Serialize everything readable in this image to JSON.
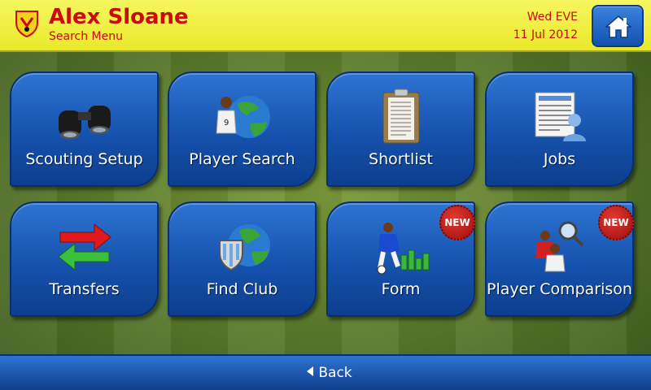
{
  "header": {
    "manager_name": "Alex Sloane",
    "screen_name": "Search Menu",
    "date_day": "Wed EVE",
    "date_full": "11 Jul 2012",
    "home_icon": "home-icon",
    "club_badge": "club-badge"
  },
  "tiles": [
    {
      "label": "Scouting Setup",
      "icon": "binoculars-icon",
      "new": false
    },
    {
      "label": "Player Search",
      "icon": "player-globe-icon",
      "new": false
    },
    {
      "label": "Shortlist",
      "icon": "clipboard-icon",
      "new": false
    },
    {
      "label": "Jobs",
      "icon": "job-listing-icon",
      "new": false
    },
    {
      "label": "Transfers",
      "icon": "transfer-arrows-icon",
      "new": false
    },
    {
      "label": "Find Club",
      "icon": "club-globe-icon",
      "new": false
    },
    {
      "label": "Form",
      "icon": "player-form-icon",
      "new": true,
      "badge": "NEW"
    },
    {
      "label": "Player Comparison",
      "icon": "player-compare-icon",
      "new": true,
      "badge": "NEW"
    }
  ],
  "footer": {
    "back_label": "Back"
  },
  "colors": {
    "header_bg": "#eded3a",
    "header_text": "#c80c10",
    "tile_blue": "#1552ad",
    "badge_red": "#c0201a"
  }
}
